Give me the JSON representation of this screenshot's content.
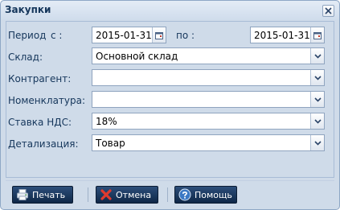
{
  "dialog": {
    "title": "Закупки"
  },
  "form": {
    "period_label": "Период",
    "from_label": "с :",
    "to_label": "по :",
    "date_from": "2015-01-31",
    "date_to": "2015-01-31",
    "warehouse_label": "Склад:",
    "warehouse_value": "Основной склад",
    "counterparty_label": "Контрагент:",
    "counterparty_value": "",
    "nomenclature_label": "Номенклатура:",
    "nomenclature_value": "",
    "vat_label": "Ставка НДС:",
    "vat_value": "18%",
    "detail_label": "Детализация:",
    "detail_value": "Товар"
  },
  "buttons": {
    "print_label": "Печать",
    "cancel_label": "Отмена",
    "help_label": "Помощь"
  },
  "icons": {
    "close": "close-icon",
    "calendar": "calendar-icon",
    "dropdown": "chevron-down-icon",
    "print": "printer-icon",
    "cancel": "cancel-x-icon",
    "help": "help-question-icon"
  }
}
